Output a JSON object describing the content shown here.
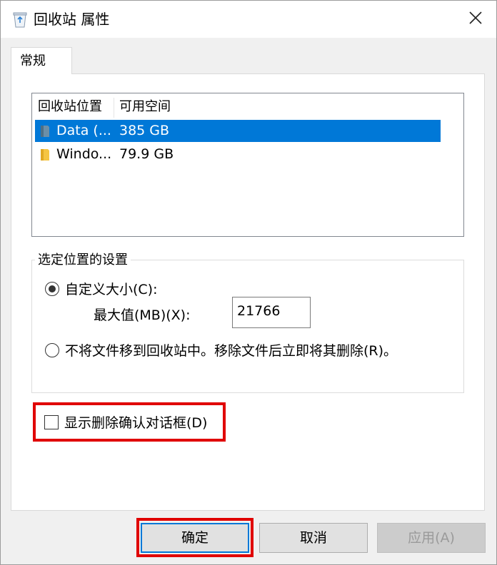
{
  "window": {
    "title": "回收站 属性"
  },
  "tabs": [
    {
      "label": "常规"
    }
  ],
  "listview": {
    "columns": [
      "回收站位置",
      "可用空间"
    ],
    "rows": [
      {
        "name": "Data (...",
        "space": "385 GB",
        "selected": true
      },
      {
        "name": "Windo...",
        "space": "79.9 GB",
        "selected": false
      }
    ]
  },
  "settings": {
    "group_label": "选定位置的设置",
    "custom_size_label": "自定义大小(C):",
    "max_size_label": "最大值(MB)(X):",
    "max_size_value": "21766",
    "no_move_label": "不将文件移到回收站中。移除文件后立即将其删除(R)。"
  },
  "confirm_dialog_label": "显示删除确认对话框(D)",
  "buttons": {
    "ok": "确定",
    "cancel": "取消",
    "apply": "应用(A)"
  },
  "colors": {
    "selection": "#0078d7",
    "highlight": "#e00000"
  }
}
